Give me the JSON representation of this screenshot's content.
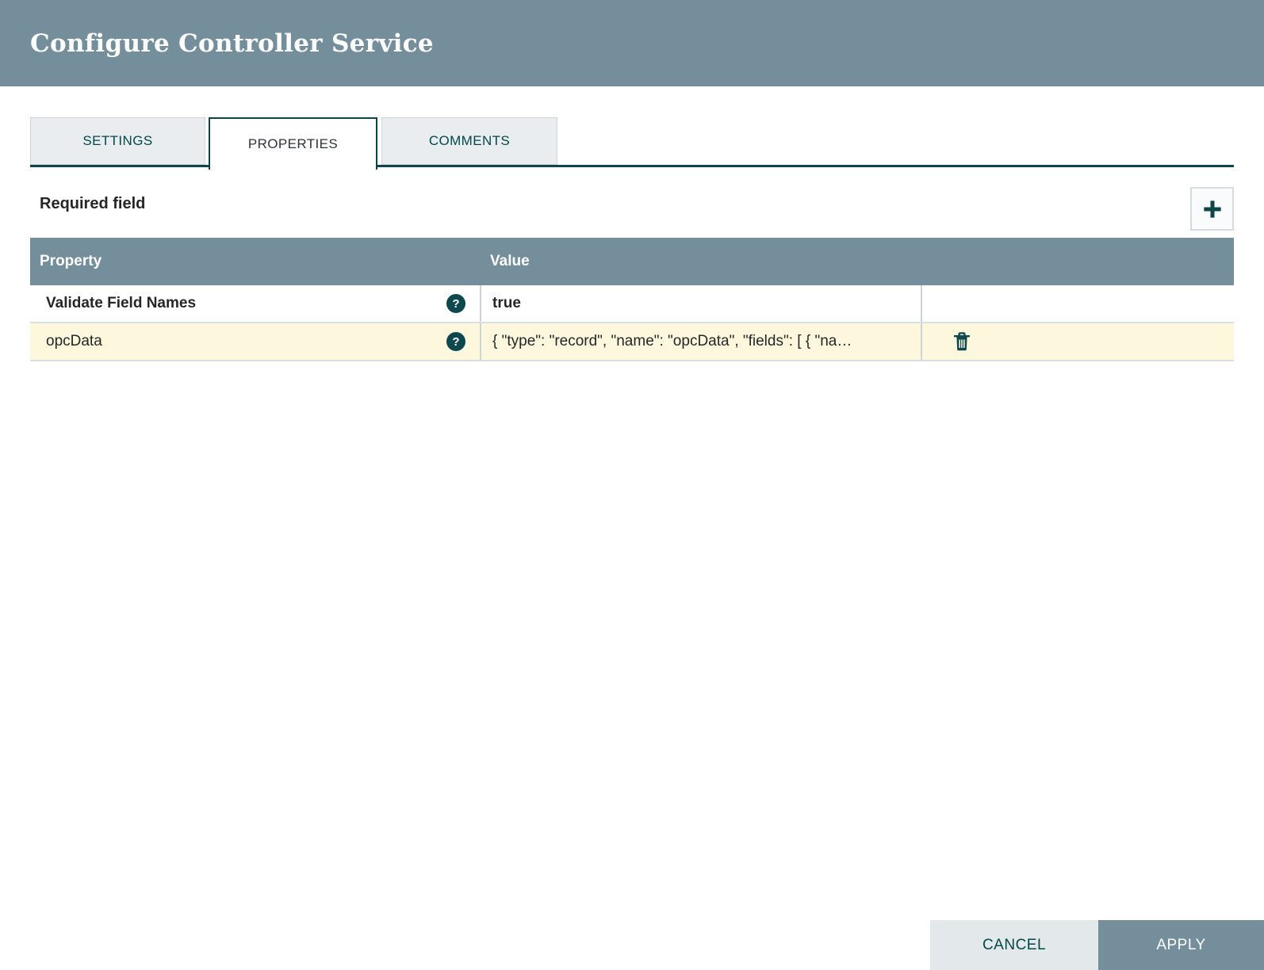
{
  "dialog": {
    "title": "Configure Controller Service"
  },
  "tabs": {
    "settings": {
      "label": "SETTINGS"
    },
    "properties": {
      "label": "PROPERTIES",
      "active": true
    },
    "comments": {
      "label": "COMMENTS"
    }
  },
  "properties_panel": {
    "required_field_label": "Required field",
    "add_button_icon": "plus-icon",
    "table": {
      "columns": {
        "property": "Property",
        "value": "Value"
      },
      "rows": [
        {
          "property": "Validate Field Names",
          "value": "true",
          "required": true,
          "highlighted": false,
          "help_icon": "question-circle"
        },
        {
          "property": "opcData",
          "value": "{ \"type\": \"record\", \"name\": \"opcData\", \"fields\": [ { \"na…",
          "required": false,
          "highlighted": true,
          "help_icon": "question-circle",
          "delete_icon": "trash-icon"
        }
      ]
    }
  },
  "icons": {
    "help_glyph": "?"
  },
  "footer": {
    "cancel_label": "CANCEL",
    "apply_label": "APPLY"
  },
  "colors": {
    "primary_slate": "#748E9B",
    "dark_teal": "#004849",
    "highlight_row": "#FCF7DD",
    "button_gray": "#E3E8EB",
    "tab_border": "#0D4449"
  }
}
